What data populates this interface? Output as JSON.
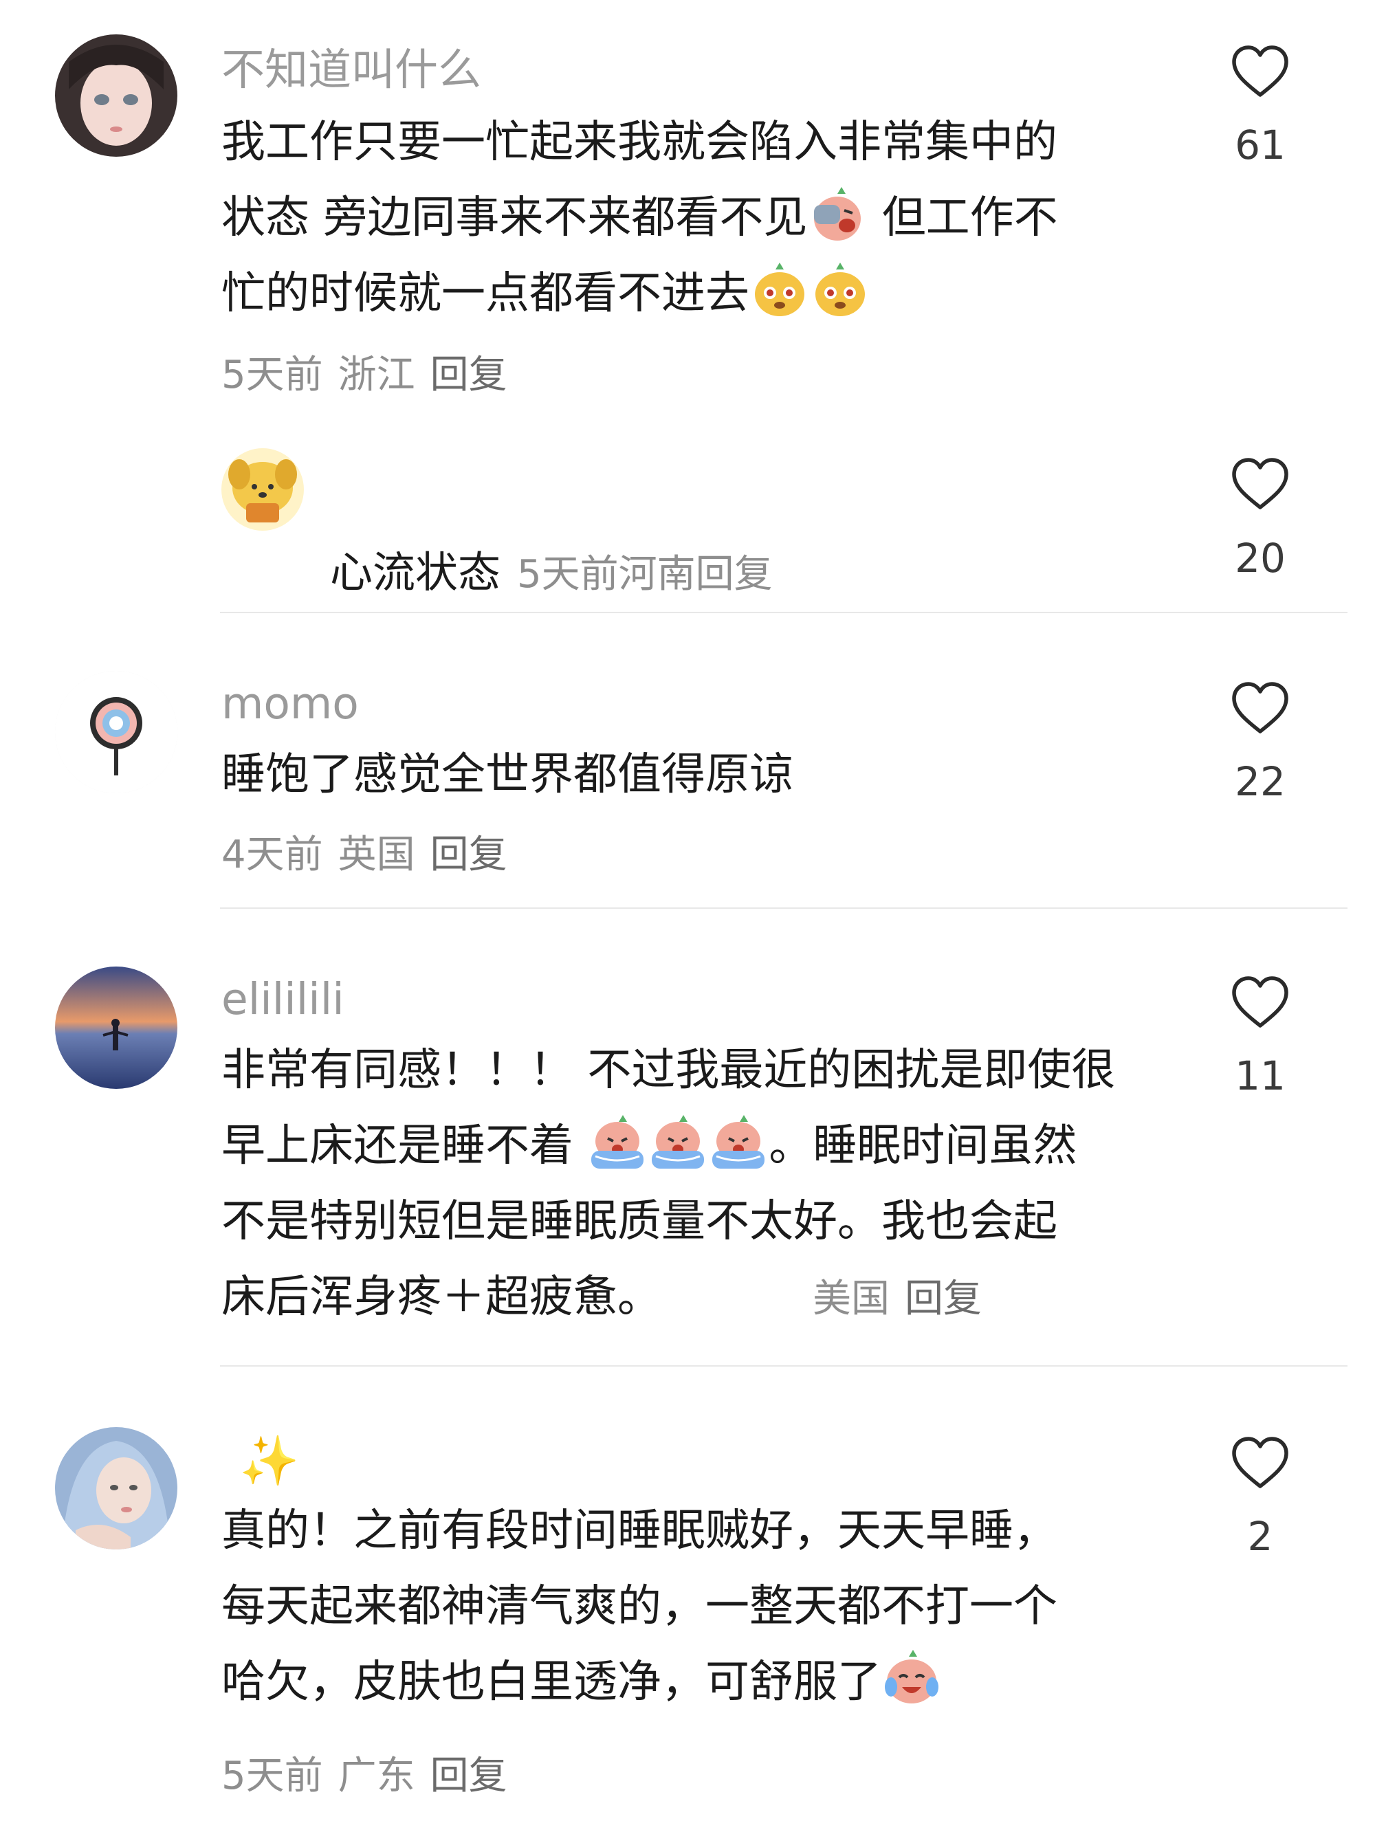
{
  "comments": [
    {
      "username": "不知道叫什么",
      "lines": [
        "我工作只要一忙起来我就会陷入非常集中的",
        "状态 旁边同事来不来都看不见",
        " 但工作不",
        "忙的时候就一点都看不进去"
      ],
      "time": "5天前",
      "location": "浙江",
      "reply_label": "回复",
      "likes": "61",
      "emojis": [
        "facepalm-emoji",
        "dizzy-face-emoji",
        "dizzy-face-emoji"
      ]
    },
    {
      "username": "心流状态",
      "lines": [],
      "time": "5天前",
      "location": "河南",
      "reply_label": "回复",
      "likes": "20"
    },
    {
      "username": "momo",
      "lines": [
        "睡饱了感觉全世界都值得原谅"
      ],
      "time": "4天前",
      "location": "英国",
      "reply_label": "回复",
      "likes": "22"
    },
    {
      "username": "elililili",
      "lines": [
        "非常有同感！！！ 不过我最近的困扰是即使很",
        "早上床还是睡不着 ",
        "。睡眠时间虽然",
        "不是特别短但是睡眠质量不太好。我也会起",
        "床后浑身疼＋超疲惫。"
      ],
      "time": "",
      "location": "美国",
      "reply_label": "回复",
      "likes": "11",
      "emojis": [
        "crying-emoji",
        "crying-emoji",
        "crying-emoji"
      ]
    },
    {
      "username": "✨",
      "lines": [
        "真的！之前有段时间睡眠贼好，天天早睡，",
        "每天起来都神清气爽的，一整天都不打一个",
        "哈欠，皮肤也白里透净，可舒服了"
      ],
      "time": "5天前",
      "location": "广东",
      "reply_label": "回复",
      "likes": "2",
      "emojis": [
        "laugh-cry-emoji"
      ]
    }
  ],
  "colors": {
    "background": "#ffffff",
    "username": "#9a9a9a",
    "content": "#1b1b1b",
    "meta": "#8e8e8e",
    "divider": "#e8e8e8"
  }
}
